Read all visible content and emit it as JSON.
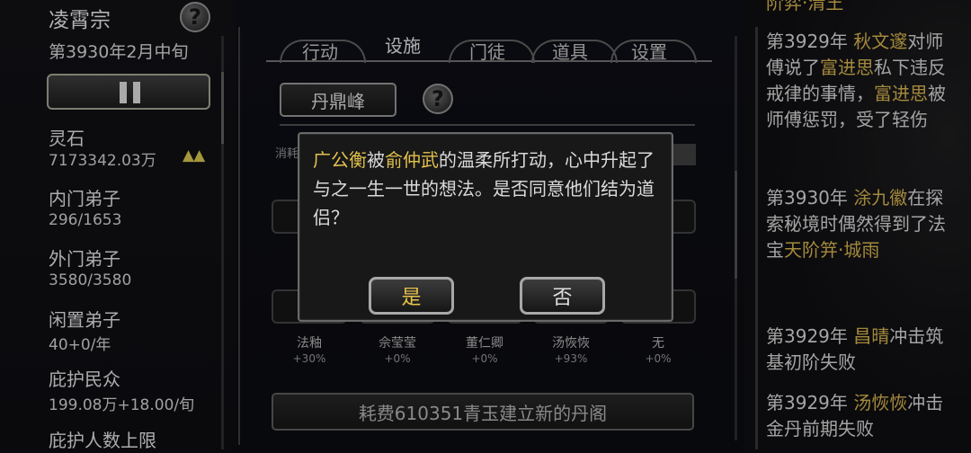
{
  "sidebar": {
    "sect_name": "凌霄宗",
    "help_glyph": "?",
    "date": "第3930年2月中旬",
    "stats": [
      {
        "label": "灵石",
        "value": "7173342.03万"
      },
      {
        "label": "内门弟子",
        "value": "296/1653"
      },
      {
        "label": "外门弟子",
        "value": "3580/3580"
      },
      {
        "label": "闲置弟子",
        "value": "40+0/年"
      },
      {
        "label": "庇护民众",
        "value": "199.08万+18.00/旬"
      },
      {
        "label": "庇护人数上限",
        "value": ""
      }
    ],
    "trend_arrows": "▲▲"
  },
  "tabs": [
    {
      "label": "行动"
    },
    {
      "label": "设施"
    },
    {
      "label": "门徒"
    },
    {
      "label": "道具"
    },
    {
      "label": "设置"
    }
  ],
  "facility": {
    "peak_name": "丹鼎峰",
    "help_glyph": "?",
    "partial_tag": "消耗",
    "slots_row1": [
      "",
      "",
      "",
      "",
      ""
    ],
    "disciples": [
      {
        "name": "法釉",
        "bonus": "+30%"
      },
      {
        "name": "佘莹莹",
        "bonus": "+0%"
      },
      {
        "name": "董仁卿",
        "bonus": "+0%"
      },
      {
        "name": "汤恢恢",
        "bonus": "+93%"
      },
      {
        "name": "无",
        "bonus": "+0%"
      }
    ],
    "build_button": "耗费610351青玉建立新的丹阁"
  },
  "log": [
    {
      "parts": [
        {
          "t": "阶弈·清王",
          "hl": true
        }
      ]
    },
    {
      "parts": [
        {
          "t": "第3929年 ",
          "hl": false
        },
        {
          "t": "秋文邃",
          "hl": true
        },
        {
          "t": "对师傅说了",
          "hl": false
        },
        {
          "t": "富进思",
          "hl": true
        },
        {
          "t": "私下违反戒律的事情，",
          "hl": false
        },
        {
          "t": "富进思",
          "hl": true
        },
        {
          "t": "被师傅惩罚，受了轻伤",
          "hl": false
        }
      ]
    },
    {
      "parts": [
        {
          "t": "第3930年 ",
          "hl": false
        },
        {
          "t": "涂九徽",
          "hl": true
        },
        {
          "t": "在探索秘境时偶然得到了法宝",
          "hl": false
        },
        {
          "t": "天阶笄·城雨",
          "hl": true
        }
      ]
    },
    {
      "parts": [
        {
          "t": "第3929年 ",
          "hl": false
        },
        {
          "t": "昌晴",
          "hl": true
        },
        {
          "t": "冲击筑基初阶失败",
          "hl": false
        }
      ]
    },
    {
      "parts": [
        {
          "t": "第3929年 ",
          "hl": false
        },
        {
          "t": "汤恢恢",
          "hl": true
        },
        {
          "t": "冲击金丹前期失败",
          "hl": false
        }
      ]
    }
  ],
  "dialog": {
    "name1": "广公衡",
    "text1": "被",
    "name2": "俞仲武",
    "text2": "的温柔所打动，心中升起了与之一生一世的想法。是否同意他们结为道侣？",
    "yes_label": "是",
    "no_label": "否"
  },
  "colors": {
    "highlight": "#c9a84a",
    "dialog_name": "#e2c14e"
  }
}
